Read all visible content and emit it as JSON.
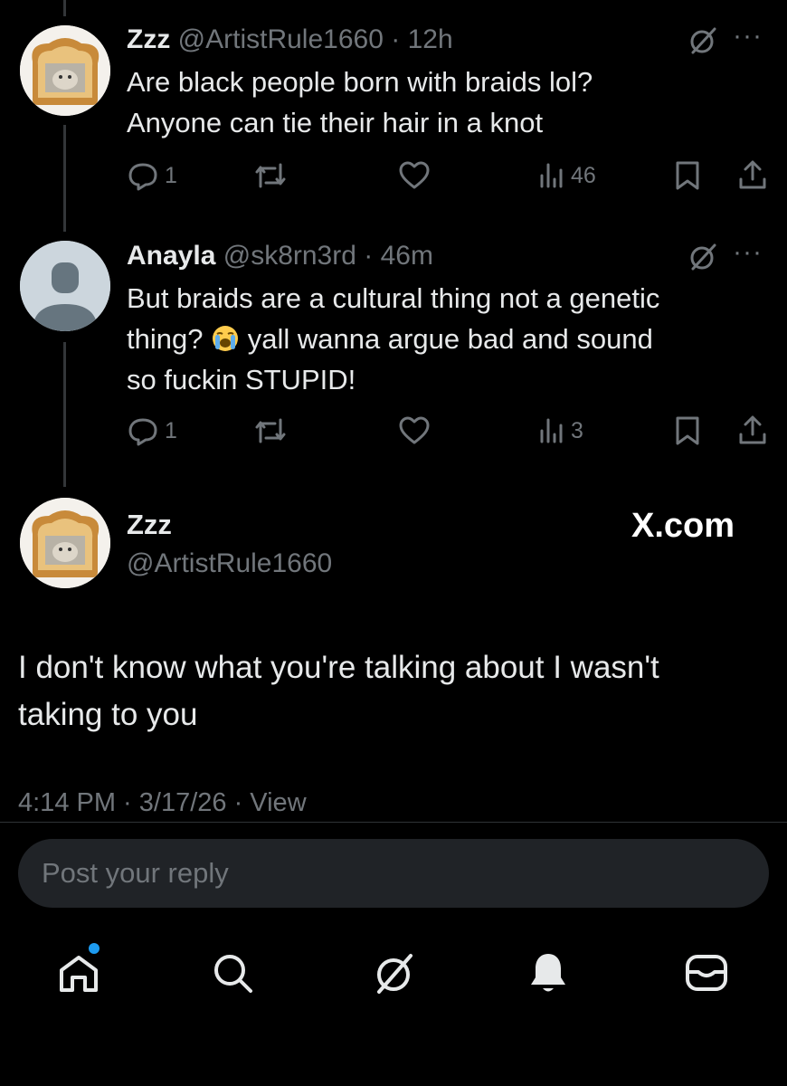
{
  "thread": [
    {
      "name": "Zzz",
      "handle": "@ArtistRule1660",
      "time": "12h",
      "lines": [
        "Are black people born with braids lol?",
        "Anyone can tie their hair in a knot"
      ],
      "replies": "1",
      "views": "46"
    },
    {
      "name": "Anayla",
      "handle": "@sk8rn3rd",
      "time": "46m",
      "line1": "But braids are a cultural thing not a genetic",
      "line2a": "thing?",
      "line2b": "yall wanna argue bad and sound",
      "line3": "so fuckin STUPID!",
      "replies": "1",
      "views": "3"
    }
  ],
  "main": {
    "name": "Zzz",
    "handle": "@ArtistRule1660",
    "watermark": "X.com",
    "lines": [
      "I don't know what you're talking about I wasn't",
      "taking to you"
    ],
    "meta": "4:14 PM · 3/17/26 · View"
  },
  "reply": {
    "placeholder": "Post your reply"
  },
  "separator": "·",
  "more_glyph": "···",
  "icons": {
    "reply": "reply-icon",
    "repost": "repost-icon",
    "like": "heart-icon",
    "views": "views-icon",
    "bookmark": "bookmark-icon",
    "share": "share-icon",
    "grok": "grok-icon",
    "home": "home-icon",
    "search": "search-icon",
    "notifications": "bell-icon",
    "messages": "mail-icon"
  },
  "colors": {
    "background": "#000000",
    "text": "#e7e9ea",
    "muted": "#71767b",
    "accent": "#1d9bf0",
    "input": "#202327"
  }
}
